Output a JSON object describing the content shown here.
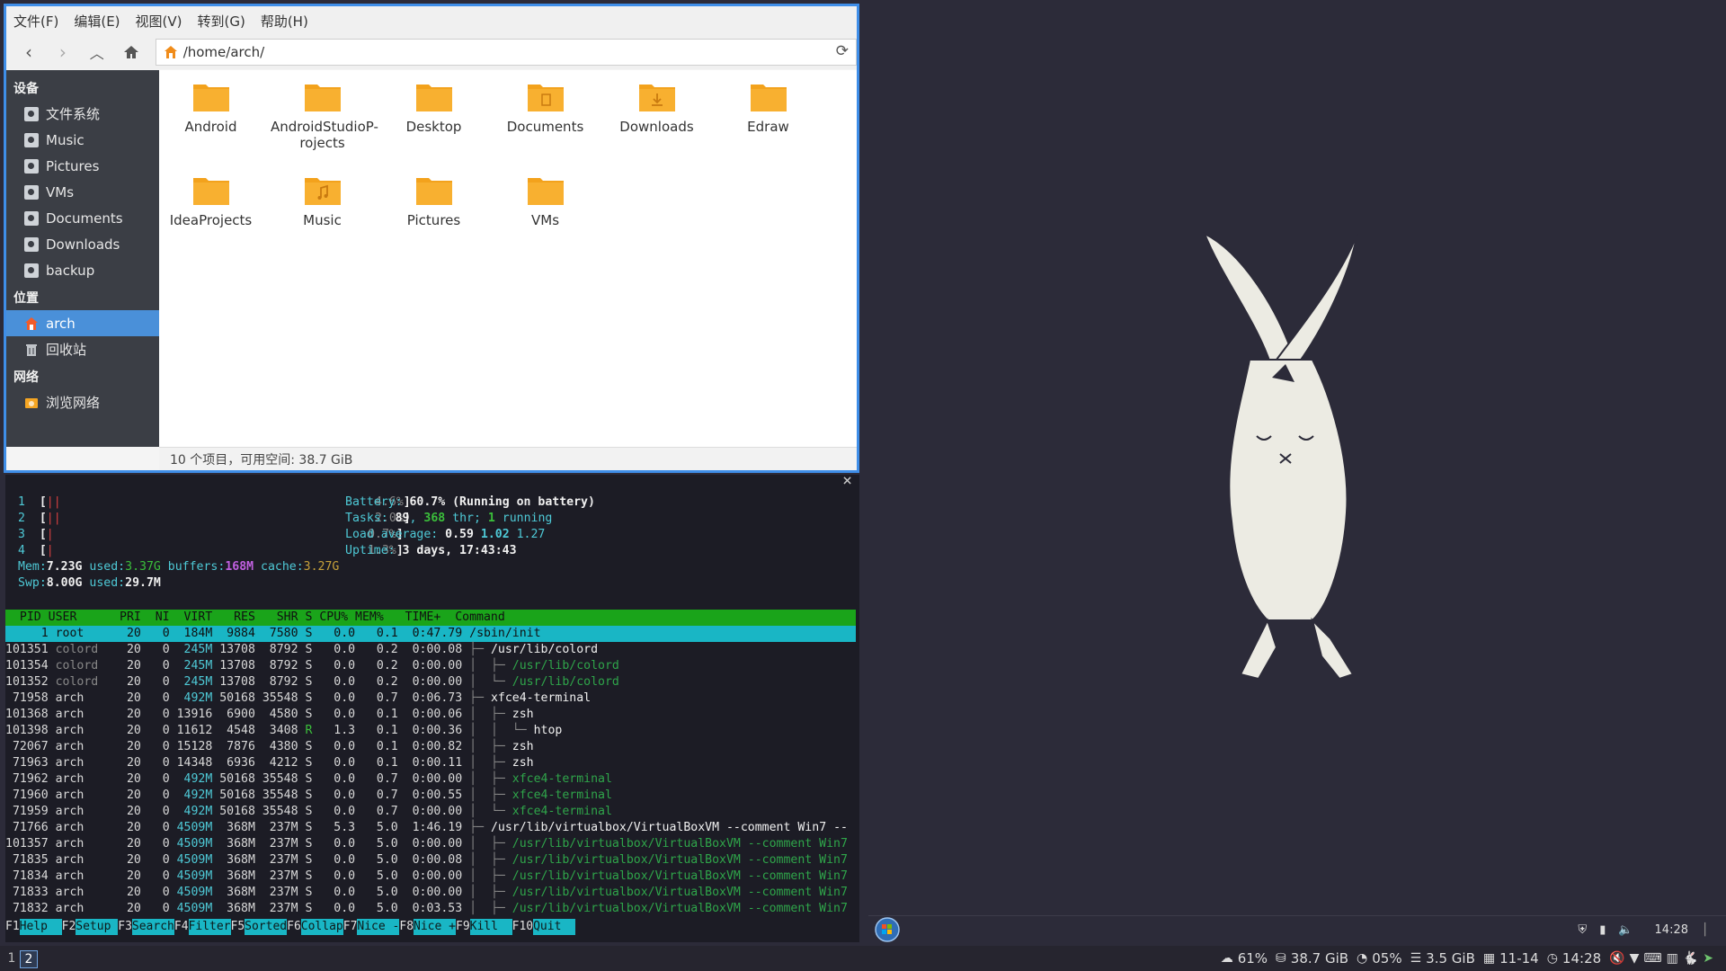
{
  "file_manager": {
    "menu": [
      "文件(F)",
      "编辑(E)",
      "视图(V)",
      "转到(G)",
      "帮助(H)"
    ],
    "path": "/home/arch/",
    "sidebar": {
      "devices_header": "设备",
      "devices": [
        "文件系统",
        "Music",
        "Pictures",
        "VMs",
        "Documents",
        "Downloads",
        "backup"
      ],
      "places_header": "位置",
      "places": [
        "arch",
        "回收站"
      ],
      "network_header": "网络",
      "network": [
        "浏览网络"
      ]
    },
    "folders": [
      "Android",
      "AndroidStudioP-\nrojects",
      "Desktop",
      "Documents",
      "Downloads",
      "Edraw",
      "IdeaProjects",
      "Music",
      "Pictures",
      "VMs"
    ],
    "status": "10 个项目，可用空间: 38.7 GiB",
    "colors": {
      "accent": "#4a90d9",
      "folder": "#f6a623",
      "sidebar_bg": "#3b3e45"
    }
  },
  "htop": {
    "cpus": [
      {
        "n": "1",
        "pct": "4.6%"
      },
      {
        "n": "2",
        "pct": "2.0%"
      },
      {
        "n": "3",
        "pct": "0.7%"
      },
      {
        "n": "4",
        "pct": "1.3%"
      }
    ],
    "battery_label": "Battery:",
    "battery_value": "60.7% (Running on battery)",
    "tasks_label": "Tasks:",
    "tasks": "89",
    "thr": "368",
    "thr_label": "thr;",
    "running": "1",
    "running_label": "running",
    "load_label": "Load average:",
    "load1": "0.59",
    "load5": "1.02",
    "load15": "1.27",
    "uptime_label": "Uptime:",
    "uptime": "3 days, 17:43:43",
    "mem_label": "Mem:",
    "mem_total": "7.23G",
    "mem_used_label": "used:",
    "mem_used": "3.37G",
    "buffers_label": "buffers:",
    "buffers": "168M",
    "cache_label": "cache:",
    "cache": "3.27G",
    "swp_label": "Swp:",
    "swp_total": "8.00G",
    "swp_used_label": "used:",
    "swp_used": "29.7M",
    "header": "  PID USER      PRI  NI  VIRT   RES   SHR S CPU% MEM%   TIME+  Command",
    "rows": [
      {
        "pid": "    1",
        "user": "root  ",
        "pri": "20",
        "ni": "0",
        "virt": " 184M",
        "res": " 9884",
        "shr": " 7580",
        "s": "S",
        "cpu": " 0.0",
        "mem": " 0.1",
        "time": "0:47.79",
        "cmd": "/sbin/init",
        "tree": ""
      },
      {
        "pid": "101351",
        "user": "colord",
        "pri": "20",
        "ni": "0",
        "virt": " 245M",
        "res": "13708",
        "shr": " 8792",
        "s": "S",
        "cpu": " 0.0",
        "mem": " 0.2",
        "time": "0:00.08",
        "cmd": "/usr/lib/colord",
        "tree": "├─ "
      },
      {
        "pid": "101354",
        "user": "colord",
        "pri": "20",
        "ni": "0",
        "virt": " 245M",
        "res": "13708",
        "shr": " 8792",
        "s": "S",
        "cpu": " 0.0",
        "mem": " 0.2",
        "time": "0:00.00",
        "cmd": "/usr/lib/colord",
        "tree": "│  ├─ "
      },
      {
        "pid": "101352",
        "user": "colord",
        "pri": "20",
        "ni": "0",
        "virt": " 245M",
        "res": "13708",
        "shr": " 8792",
        "s": "S",
        "cpu": " 0.0",
        "mem": " 0.2",
        "time": "0:00.00",
        "cmd": "/usr/lib/colord",
        "tree": "│  └─ "
      },
      {
        "pid": " 71958",
        "user": "arch  ",
        "pri": "20",
        "ni": "0",
        "virt": " 492M",
        "res": "50168",
        "shr": "35548",
        "s": "S",
        "cpu": " 0.0",
        "mem": " 0.7",
        "time": "0:06.73",
        "cmd": "xfce4-terminal",
        "tree": "├─ "
      },
      {
        "pid": "101368",
        "user": "arch  ",
        "pri": "20",
        "ni": "0",
        "virt": "13916",
        "res": " 6900",
        "shr": " 4580",
        "s": "S",
        "cpu": " 0.0",
        "mem": " 0.1",
        "time": "0:00.06",
        "cmd": "zsh",
        "tree": "│  ├─ "
      },
      {
        "pid": "101398",
        "user": "arch  ",
        "pri": "20",
        "ni": "0",
        "virt": "11612",
        "res": " 4548",
        "shr": " 3408",
        "s": "R",
        "cpu": " 1.3",
        "mem": " 0.1",
        "time": "0:00.36",
        "cmd": "htop",
        "tree": "│  │  └─ "
      },
      {
        "pid": " 72067",
        "user": "arch  ",
        "pri": "20",
        "ni": "0",
        "virt": "15128",
        "res": " 7876",
        "shr": " 4380",
        "s": "S",
        "cpu": " 0.0",
        "mem": " 0.1",
        "time": "0:00.82",
        "cmd": "zsh",
        "tree": "│  ├─ "
      },
      {
        "pid": " 71963",
        "user": "arch  ",
        "pri": "20",
        "ni": "0",
        "virt": "14348",
        "res": " 6936",
        "shr": " 4212",
        "s": "S",
        "cpu": " 0.0",
        "mem": " 0.1",
        "time": "0:00.11",
        "cmd": "zsh",
        "tree": "│  ├─ "
      },
      {
        "pid": " 71962",
        "user": "arch  ",
        "pri": "20",
        "ni": "0",
        "virt": " 492M",
        "res": "50168",
        "shr": "35548",
        "s": "S",
        "cpu": " 0.0",
        "mem": " 0.7",
        "time": "0:00.00",
        "cmd": "xfce4-terminal",
        "tree": "│  ├─ "
      },
      {
        "pid": " 71960",
        "user": "arch  ",
        "pri": "20",
        "ni": "0",
        "virt": " 492M",
        "res": "50168",
        "shr": "35548",
        "s": "S",
        "cpu": " 0.0",
        "mem": " 0.7",
        "time": "0:00.55",
        "cmd": "xfce4-terminal",
        "tree": "│  ├─ "
      },
      {
        "pid": " 71959",
        "user": "arch  ",
        "pri": "20",
        "ni": "0",
        "virt": " 492M",
        "res": "50168",
        "shr": "35548",
        "s": "S",
        "cpu": " 0.0",
        "mem": " 0.7",
        "time": "0:00.00",
        "cmd": "xfce4-terminal",
        "tree": "│  └─ "
      },
      {
        "pid": " 71766",
        "user": "arch  ",
        "pri": "20",
        "ni": "0",
        "virt": "4509M",
        "res": " 368M",
        "shr": " 237M",
        "s": "S",
        "cpu": " 5.3",
        "mem": " 5.0",
        "time": "1:46.19",
        "cmd": "/usr/lib/virtualbox/VirtualBoxVM --comment Win7 --",
        "tree": "├─ "
      },
      {
        "pid": "101357",
        "user": "arch  ",
        "pri": "20",
        "ni": "0",
        "virt": "4509M",
        "res": " 368M",
        "shr": " 237M",
        "s": "S",
        "cpu": " 0.0",
        "mem": " 5.0",
        "time": "0:00.00",
        "cmd": "/usr/lib/virtualbox/VirtualBoxVM --comment Win7",
        "tree": "│  ├─ "
      },
      {
        "pid": " 71835",
        "user": "arch  ",
        "pri": "20",
        "ni": "0",
        "virt": "4509M",
        "res": " 368M",
        "shr": " 237M",
        "s": "S",
        "cpu": " 0.0",
        "mem": " 5.0",
        "time": "0:00.08",
        "cmd": "/usr/lib/virtualbox/VirtualBoxVM --comment Win7",
        "tree": "│  ├─ "
      },
      {
        "pid": " 71834",
        "user": "arch  ",
        "pri": "20",
        "ni": "0",
        "virt": "4509M",
        "res": " 368M",
        "shr": " 237M",
        "s": "S",
        "cpu": " 0.0",
        "mem": " 5.0",
        "time": "0:00.00",
        "cmd": "/usr/lib/virtualbox/VirtualBoxVM --comment Win7",
        "tree": "│  ├─ "
      },
      {
        "pid": " 71833",
        "user": "arch  ",
        "pri": "20",
        "ni": "0",
        "virt": "4509M",
        "res": " 368M",
        "shr": " 237M",
        "s": "S",
        "cpu": " 0.0",
        "mem": " 5.0",
        "time": "0:00.00",
        "cmd": "/usr/lib/virtualbox/VirtualBoxVM --comment Win7",
        "tree": "│  ├─ "
      },
      {
        "pid": " 71832",
        "user": "arch  ",
        "pri": "20",
        "ni": "0",
        "virt": "4509M",
        "res": " 368M",
        "shr": " 237M",
        "s": "S",
        "cpu": " 0.0",
        "mem": " 5.0",
        "time": "0:03.53",
        "cmd": "/usr/lib/virtualbox/VirtualBoxVM --comment Win7",
        "tree": "│  ├─ "
      }
    ],
    "fkeys": [
      {
        "k": "F1",
        "l": "Help  "
      },
      {
        "k": "F2",
        "l": "Setup "
      },
      {
        "k": "F3",
        "l": "Search"
      },
      {
        "k": "F4",
        "l": "Filter"
      },
      {
        "k": "F5",
        "l": "Sorted"
      },
      {
        "k": "F6",
        "l": "Collap"
      },
      {
        "k": "F7",
        "l": "Nice -"
      },
      {
        "k": "F8",
        "l": "Nice +"
      },
      {
        "k": "F9",
        "l": "Kill  "
      },
      {
        "k": "F10",
        "l": "Quit  "
      }
    ]
  },
  "taskbar": {
    "clock": "14:28"
  },
  "bottom_panel": {
    "workspaces": [
      "1",
      "2"
    ],
    "current_workspace": "2",
    "cpu": "61%",
    "disk": "38.7 GiB",
    "swap": "05%",
    "mem": "3.5 GiB",
    "date": "11-14",
    "time": "14:28"
  }
}
